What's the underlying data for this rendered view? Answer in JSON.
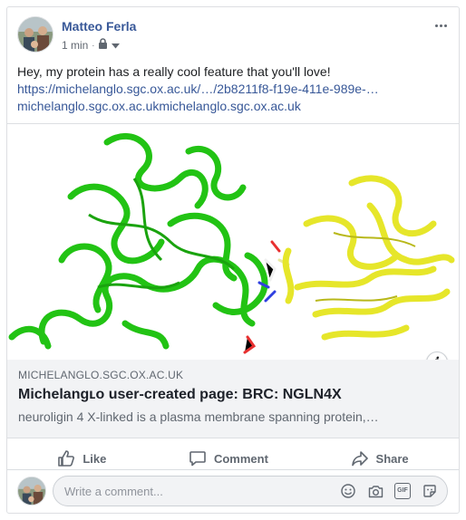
{
  "post": {
    "author": "Matteo Ferla",
    "time": "1 min",
    "text": "Hey, my protein has a really cool feature that you'll love!",
    "link_url": "https://michelanglo.sgc.ox.ac.uk/…/2b8211f8-f19e-411e-989e-…",
    "link_domains": "michelanglo.sgc.ox.ac.ukmichelanglo.sgc.ox.ac.uk"
  },
  "preview": {
    "domain": "MICHELANGLO.SGC.OX.AC.UK",
    "title": "Michelangʟᴏ user-created page: BRC: NGLN4X",
    "description": "neuroligin 4 X-linked is a plasma membrane spanning protein,…",
    "info_glyph": "i"
  },
  "actions": {
    "like": "Like",
    "comment": "Comment",
    "share": "Share"
  },
  "comment_box": {
    "placeholder": "Write a comment...",
    "gif_label": "GIF"
  },
  "colors": {
    "link": "#385898",
    "secondary_text": "#606770",
    "protein_green": "#22c314",
    "protein_yellow": "#e6e62a"
  },
  "icons": [
    "lock-icon",
    "dropdown-icon",
    "more-options-icon",
    "info-icon",
    "like-icon",
    "comment-icon",
    "share-icon",
    "emoji-icon",
    "camera-icon",
    "gif-icon",
    "sticker-icon"
  ]
}
